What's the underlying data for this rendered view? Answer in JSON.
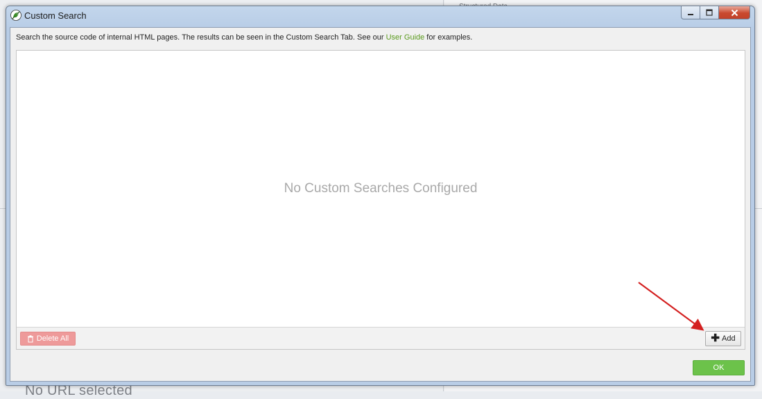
{
  "background": {
    "bottom_text": "No URL selected",
    "top_text": "Structured Data"
  },
  "dialog": {
    "title": "Custom Search",
    "app_icon": "spider-frog-icon",
    "controls": {
      "minimize": "minimize-icon",
      "maximize": "maximize-icon",
      "close": "close-icon"
    },
    "info": {
      "text_before": "Search the source code of internal HTML pages. The results can be seen in the Custom Search Tab. See our ",
      "link": "User Guide",
      "text_after": " for examples."
    },
    "panel": {
      "empty_message": "No Custom Searches Configured",
      "delete_all_label": "Delete All",
      "add_label": "Add"
    },
    "ok_label": "OK"
  },
  "colors": {
    "link": "#5a9a1d",
    "ok_button": "#6cc24a",
    "delete_button": "#ee9a9a",
    "annotation_arrow": "#d42020"
  }
}
